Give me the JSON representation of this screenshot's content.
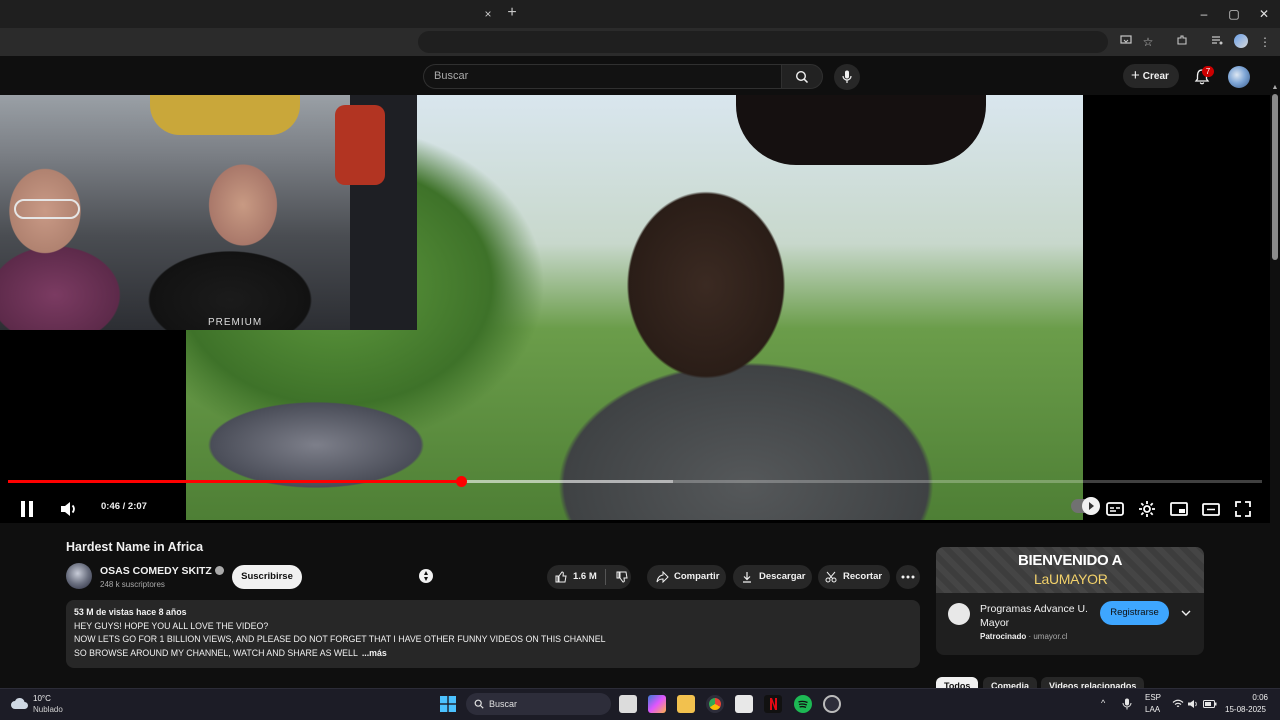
{
  "browser": {
    "tab_close": "×",
    "tab_new": "+",
    "window_controls": [
      "–",
      "▢",
      "✕"
    ]
  },
  "header": {
    "search_placeholder": "Buscar",
    "create_label": "Crear",
    "notifications_count": "7"
  },
  "player": {
    "current_time": "0:46",
    "duration": "2:07",
    "time_display": "0:46 / 2:07",
    "progress_fraction": 0.362,
    "buffer_fraction": 0.53,
    "facecam_shirt_text": "PREMIUM",
    "accent_color": "#ff0000"
  },
  "video": {
    "title": "Hardest Name in Africa",
    "channel_name": "OSAS COMEDY SKITZ",
    "subscribers": "248 k suscriptores",
    "subscribe_label": "Suscribirse",
    "like_count": "1.6 M",
    "share_label": "Compartir",
    "download_label": "Descargar",
    "clip_label": "Recortar"
  },
  "description": {
    "meta": "53 M de vistas  hace 8 años",
    "lines": [
      "HEY GUYS! HOPE YOU ALL LOVE THE VIDEO?",
      "NOW LETS GO FOR 1 BILLION VIEWS, AND PLEASE DO NOT FORGET THAT I HAVE OTHER FUNNY VIDEOS ON THIS CHANNEL",
      "SO BROWSE AROUND MY CHANNEL, WATCH AND SHARE AS WELL"
    ],
    "more_label": "...más"
  },
  "ad": {
    "banner_title": "BIENVENIDO A",
    "banner_subtitle": "LaUMAYOR",
    "headline": "Programas Advance U. Mayor",
    "sponsor_label": "Patrocinado",
    "sponsor_domain": "umayor.cl",
    "cta_label": "Registrarse",
    "cta_color": "#3ea6ff"
  },
  "chips": [
    "Todos",
    "Comedia",
    "Videos relacionados"
  ],
  "taskbar": {
    "weather_temp": "10°C",
    "weather_desc": "Nublado",
    "search_label": "Buscar",
    "lang_line1": "ESP",
    "lang_line2": "LAA",
    "time": "0:06",
    "date": "15-08-2025"
  }
}
